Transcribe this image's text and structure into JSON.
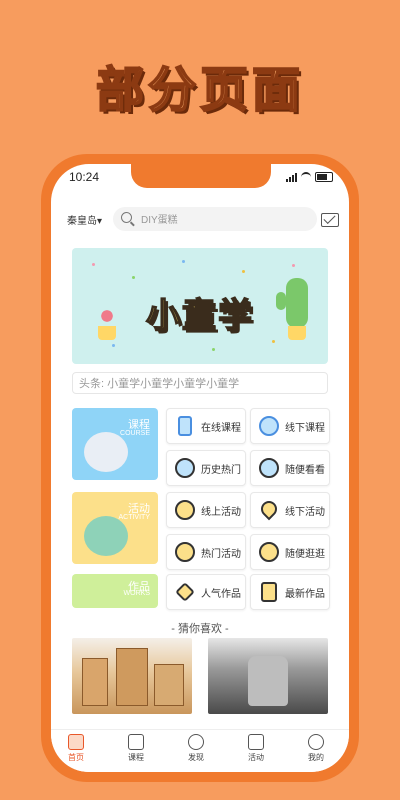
{
  "poster": {
    "title": "部分页面"
  },
  "status": {
    "time": "10:24"
  },
  "topbar": {
    "city": "秦皇岛",
    "city_arrow": "▾",
    "search_placeholder": "DIY蛋糕"
  },
  "banner": {
    "title": "小童学"
  },
  "headline": {
    "label": "头条:",
    "text": "小童学小童学小童学小童学"
  },
  "categories": [
    {
      "title": "课程",
      "subtitle": "COURSE",
      "color": "#8FD4F7"
    },
    {
      "title": "活动",
      "subtitle": "ACTIVITY",
      "color": "#FCE08A"
    },
    {
      "title": "作品",
      "subtitle": "WORKS",
      "color": "#CFEF9A"
    }
  ],
  "tiles": [
    {
      "label": "在线课程",
      "icon": "phone-icon"
    },
    {
      "label": "线下课程",
      "icon": "guitar-icon"
    },
    {
      "label": "历史热门",
      "icon": "clock-icon"
    },
    {
      "label": "随便看看",
      "icon": "search-icon"
    },
    {
      "label": "线上活动",
      "icon": "chat-icon"
    },
    {
      "label": "线下活动",
      "icon": "location-icon"
    },
    {
      "label": "热门活动",
      "icon": "bulb-icon"
    },
    {
      "label": "随便逛逛",
      "icon": "search-icon"
    },
    {
      "label": "人气作品",
      "icon": "diamond-icon"
    },
    {
      "label": "最新作品",
      "icon": "document-icon"
    }
  ],
  "guess": {
    "title": "- 猜你喜欢 -"
  },
  "tabs": [
    {
      "label": "首页",
      "icon": "home-icon"
    },
    {
      "label": "课程",
      "icon": "book-icon"
    },
    {
      "label": "发现",
      "icon": "discover-icon"
    },
    {
      "label": "活动",
      "icon": "map-icon"
    },
    {
      "label": "我的",
      "icon": "profile-icon"
    }
  ]
}
